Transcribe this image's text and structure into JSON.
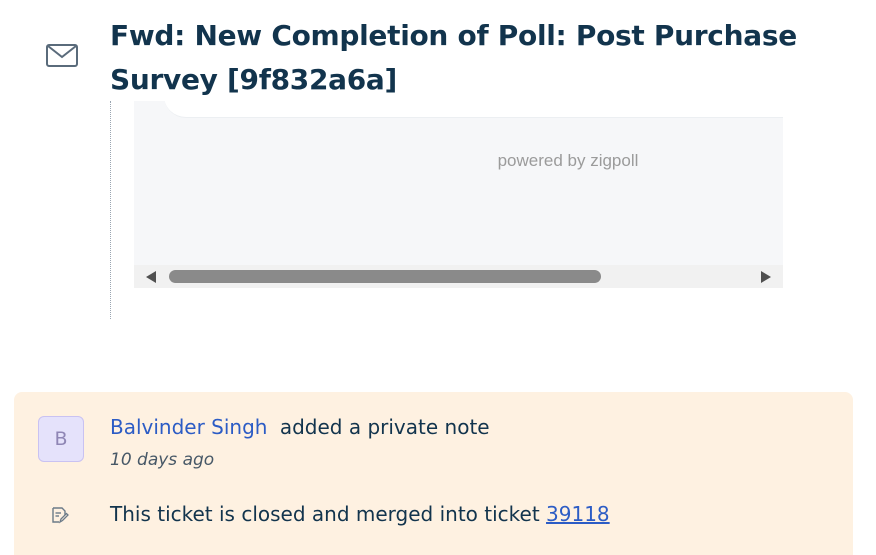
{
  "email": {
    "icon": "mail-icon",
    "subject": "Fwd: New Completion of Poll: Post Purchase Survey [9f832a6a]",
    "embedded_frame": {
      "powered_by": "powered by zigpoll",
      "has_horizontal_scrollbar": true
    }
  },
  "private_note": {
    "avatar_initial": "B",
    "author": "Balvinder Singh",
    "action": "added a private note",
    "time": "10 days ago",
    "note_icon": "note-edit-icon",
    "text_prefix": "This ticket is closed and merged into ticket",
    "ticket_link": "39118",
    "colors": {
      "card_background": "#fef1e1",
      "link": "#2c5cc5",
      "avatar_background": "#e5e2fb"
    }
  }
}
